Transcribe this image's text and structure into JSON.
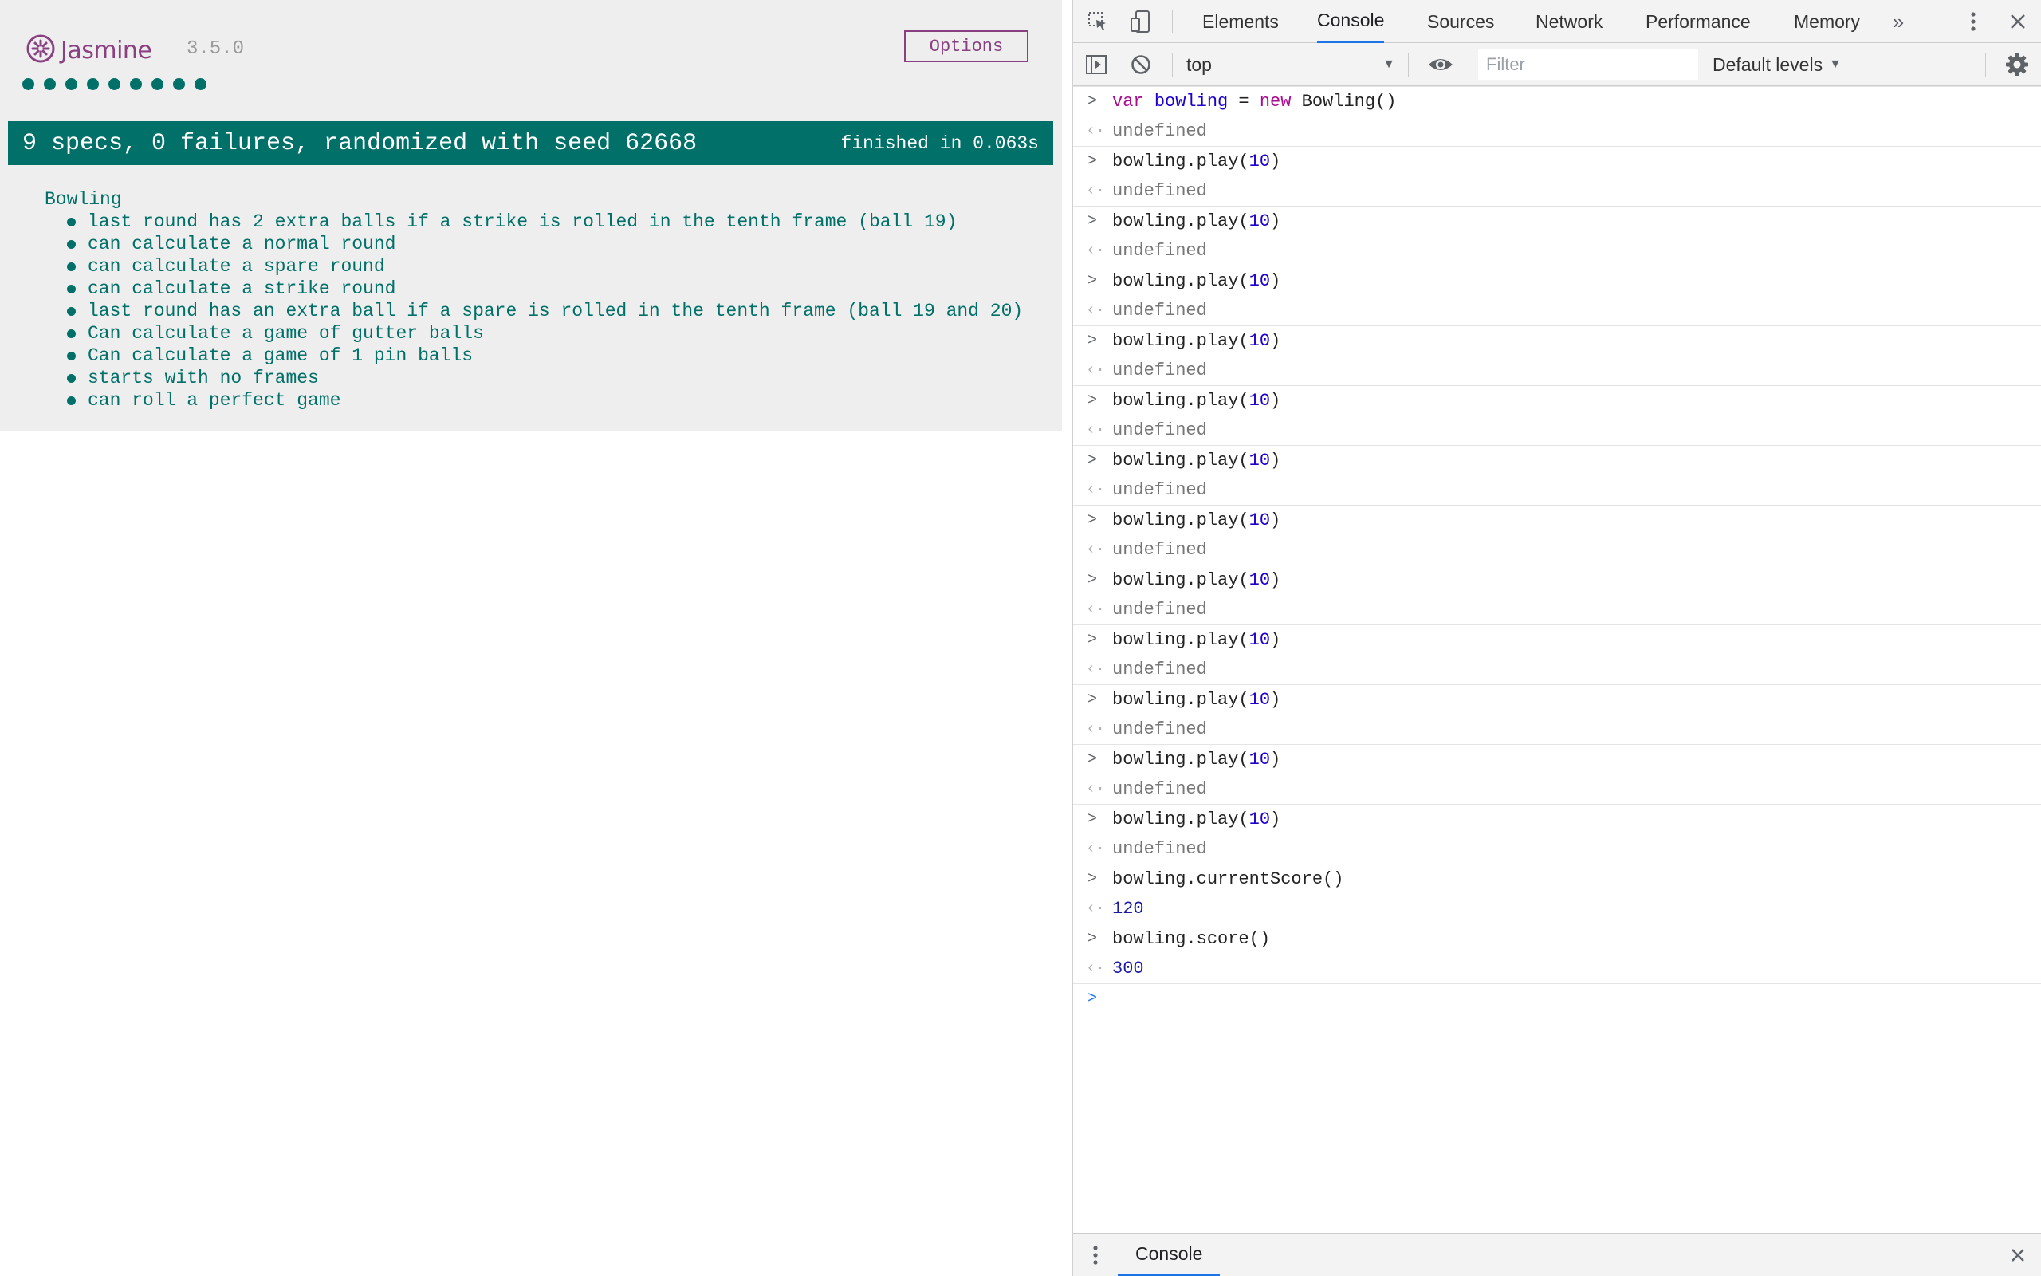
{
  "jasmine": {
    "logo_text": "Jasmine",
    "version": "3.5.0",
    "options_label": "Options",
    "dot_count": 9,
    "summary": "9 specs, 0 failures, randomized with seed 62668",
    "duration": "finished in 0.063s",
    "suite_name": "Bowling",
    "specs": [
      "last round has 2 extra balls if a strike is rolled in the tenth frame (ball 19)",
      "can calculate a normal round",
      "can calculate a spare round",
      "can calculate a strike round",
      "last round has an extra ball if a spare is rolled in the tenth frame (ball 19 and 20)",
      "Can calculate a game of gutter balls",
      "Can calculate a game of 1 pin balls",
      "starts with no frames",
      "can roll a perfect game"
    ],
    "colors": {
      "accent": "#007069",
      "brand": "#8a4182",
      "header_bg": "#eeeeee"
    }
  },
  "devtools": {
    "tabs": [
      "Elements",
      "Console",
      "Sources",
      "Network",
      "Performance",
      "Memory"
    ],
    "active_tab": "Console",
    "more_tabs_icon": "double-chevron-right-icon",
    "context": "top",
    "filter_placeholder": "Filter",
    "levels": "Default levels",
    "drawer_tab": "Console",
    "console_entries": [
      {
        "input": "var bowling = new Bowling()",
        "output": "undefined"
      },
      {
        "input": "bowling.play(10)",
        "output": "undefined"
      },
      {
        "input": "bowling.play(10)",
        "output": "undefined"
      },
      {
        "input": "bowling.play(10)",
        "output": "undefined"
      },
      {
        "input": "bowling.play(10)",
        "output": "undefined"
      },
      {
        "input": "bowling.play(10)",
        "output": "undefined"
      },
      {
        "input": "bowling.play(10)",
        "output": "undefined"
      },
      {
        "input": "bowling.play(10)",
        "output": "undefined"
      },
      {
        "input": "bowling.play(10)",
        "output": "undefined"
      },
      {
        "input": "bowling.play(10)",
        "output": "undefined"
      },
      {
        "input": "bowling.play(10)",
        "output": "undefined"
      },
      {
        "input": "bowling.play(10)",
        "output": "undefined"
      },
      {
        "input": "bowling.play(10)",
        "output": "undefined"
      },
      {
        "input": "bowling.currentScore()",
        "output": "120"
      },
      {
        "input": "bowling.score()",
        "output": "300"
      }
    ],
    "colors": {
      "tab_active_underline": "#1a73e8",
      "toolbar_bg": "#f3f3f3",
      "keyword": "#aa0d91",
      "number": "#1c00cf"
    }
  }
}
